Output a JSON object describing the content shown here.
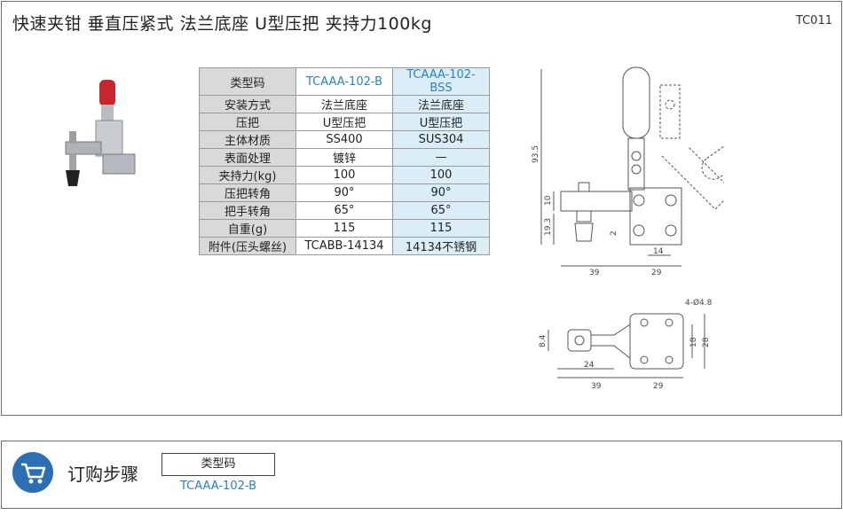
{
  "header": {
    "title": "快速夹钳  垂直压紧式  法兰底座  U型压把  夹持力100kg",
    "code": "TC011"
  },
  "spec_table": {
    "header": [
      "类型码",
      "TCAAA-102-B",
      "TCAAA-102-BSS"
    ],
    "rows": [
      [
        "安装方式",
        "法兰底座",
        "法兰底座"
      ],
      [
        "压把",
        "U型压把",
        "U型压把"
      ],
      [
        "主体材质",
        "SS400",
        "SUS304"
      ],
      [
        "表面处理",
        "镀锌",
        "—"
      ],
      [
        "夹持力(kg)",
        "100",
        "100"
      ],
      [
        "压把转角",
        "90°",
        "90°"
      ],
      [
        "把手转角",
        "65°",
        "65°"
      ],
      [
        "自重(g)",
        "115",
        "115"
      ],
      [
        "附件(压头螺丝)",
        "TCABB-14134",
        "14134不锈钢"
      ]
    ]
  },
  "drawing": {
    "dims": {
      "height_total": "93.5",
      "d10": "10",
      "d19_3": "19.3",
      "d2": "2",
      "d14": "14",
      "d39": "39",
      "d29": "29",
      "holes": "4-Ø4.8",
      "d8_4": "8.4",
      "d18": "18",
      "d28": "28",
      "d24": "24",
      "d39b": "39",
      "d29b": "29"
    }
  },
  "order": {
    "title": "订购步骤",
    "box_label": "类型码",
    "code": "TCAAA-102-B"
  },
  "colors": {
    "accent": "#2b7fc3",
    "cart": "#2d6fb5",
    "row_alt": "#dbeef8",
    "header_cell": "#d9d9d9"
  }
}
